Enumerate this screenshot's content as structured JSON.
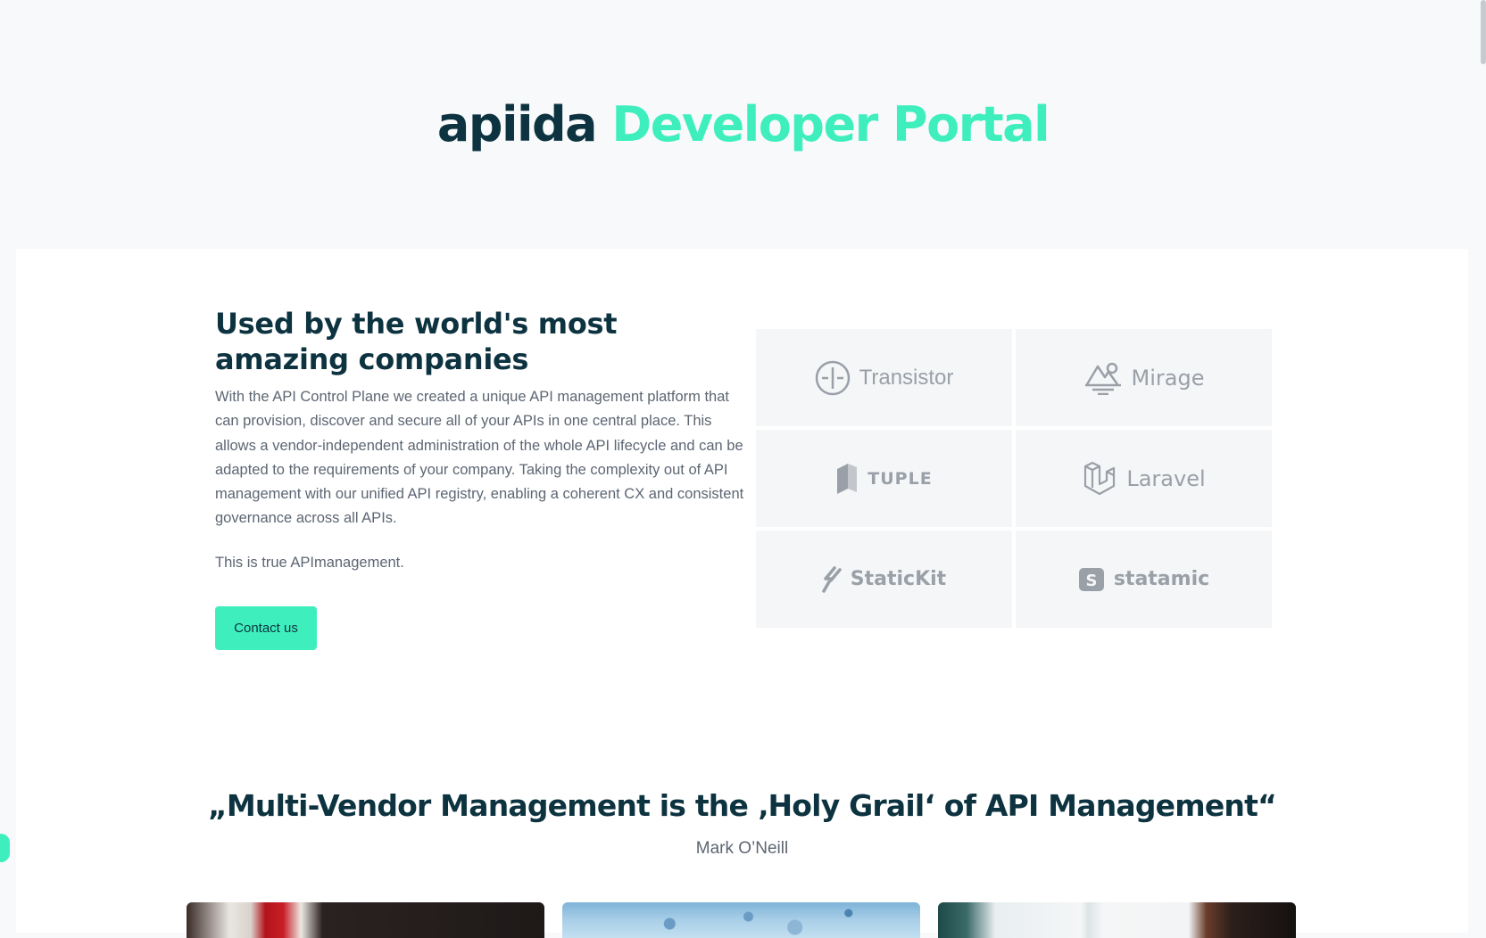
{
  "hero": {
    "brand": "apiida",
    "accent": "Developer Portal"
  },
  "intro": {
    "heading": "Used by the world's most amazing companies",
    "body": "With the API Control Plane we created a unique API management platform that can provision, discover and secure all of your APIs in one central place. This allows a vendor-independent administration of the whole API lifecycle and can be adapted to the requirements of your company. Taking the complexity out of API management with our unified API registry, enabling a coherent CX and consistent governance across all APIs.",
    "tagline": "This is true APImanagement.",
    "contact_label": "Contact us"
  },
  "logos": [
    {
      "name": "Transistor",
      "icon": "transistor-icon"
    },
    {
      "name": "Mirage",
      "icon": "mirage-icon"
    },
    {
      "name": "TUPLE",
      "icon": "tuple-icon"
    },
    {
      "name": "Laravel",
      "icon": "laravel-icon"
    },
    {
      "name": "StaticKit",
      "icon": "statickit-icon"
    },
    {
      "name": "statamic",
      "icon": "statamic-icon"
    }
  ],
  "quote": {
    "text": "„Multi-Vendor Management is the ‚Holy Grail‘ of API Management“",
    "author": "Mark O’Neill"
  },
  "colors": {
    "brand_dark": "#0d3340",
    "accent": "#3eefbd",
    "body_text": "#5d6673",
    "logo_gray": "#9aa0a8"
  }
}
